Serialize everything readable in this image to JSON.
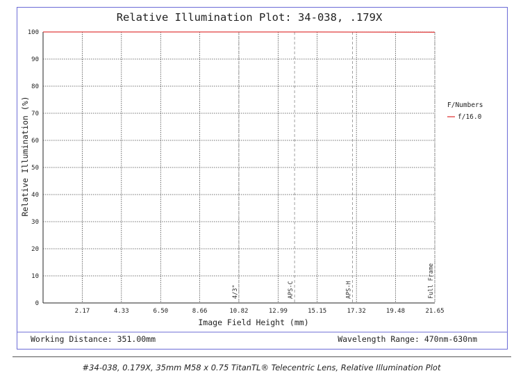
{
  "chart_data": {
    "type": "line",
    "title": "Relative Illumination Plot: 34-038, .179X",
    "xlabel": "Image Field Height (mm)",
    "ylabel": "Relative Illumination (%)",
    "x_ticks": [
      "2.17",
      "4.33",
      "6.50",
      "8.66",
      "10.82",
      "12.99",
      "15.15",
      "17.32",
      "19.48",
      "21.65"
    ],
    "y_ticks": [
      "0",
      "10",
      "20",
      "30",
      "40",
      "50",
      "60",
      "70",
      "80",
      "90",
      "100"
    ],
    "xlim": [
      0,
      21.65
    ],
    "ylim": [
      0,
      100
    ],
    "grid": true,
    "legend": {
      "title": "F/Numbers",
      "placement": "right"
    },
    "series": [
      {
        "name": "f/16.0",
        "color": "#e03c3c",
        "x": [
          0,
          5,
          10,
          15,
          21.65
        ],
        "y": [
          100,
          100,
          100,
          100,
          99.9
        ]
      }
    ],
    "sensor_markers": [
      {
        "label": "4/3\"",
        "x": 10.82
      },
      {
        "label": "APS-C",
        "x": 13.9
      },
      {
        "label": "APS-H",
        "x": 17.1
      },
      {
        "label": "Full Frame",
        "x": 21.65
      }
    ]
  },
  "info": {
    "working_distance": "Working Distance: 351.00mm",
    "wavelength_range": "Wavelength Range: 470nm-630nm"
  },
  "caption": "#34-038, 0.179X, 35mm M58 x 0.75 TitanTL® Telecentric Lens, Relative Illumination Plot",
  "colors": {
    "frame": "#6b6bd6",
    "grid": "#444444",
    "axis": "#222222",
    "marker": "#888888"
  }
}
